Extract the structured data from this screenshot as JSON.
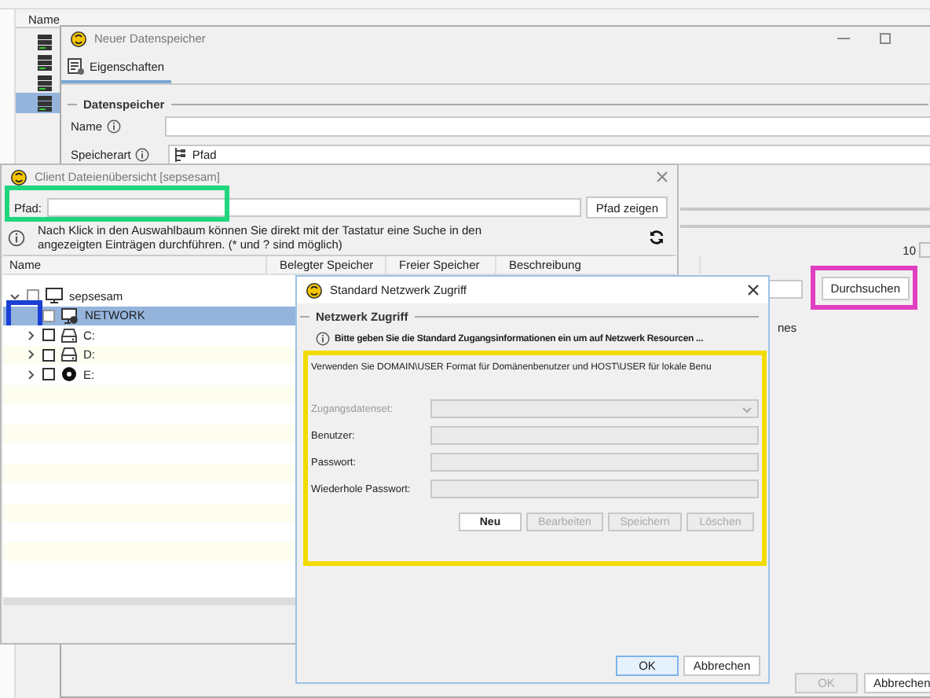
{
  "main": {
    "columns": [
      {
        "label": "Name"
      }
    ],
    "rows": [
      {
        "selected": false
      },
      {
        "selected": false
      },
      {
        "selected": false
      },
      {
        "selected": true
      }
    ]
  },
  "datastore_window": {
    "title": "Neuer Datenspeicher",
    "tabs": [
      {
        "label": "Eigenschaften",
        "selected": true
      }
    ],
    "group": "Datenspeicher",
    "fields": [
      {
        "label": "Name",
        "kind": "text"
      },
      {
        "label": "Speicherart",
        "kind": "select",
        "value": "Pfad"
      }
    ],
    "spinner_value": "10",
    "browse_button": "Durchsuchen",
    "partial_label": "nes",
    "buttons": [
      {
        "label": "OK",
        "disabled": true
      },
      {
        "label": "Abbrechen",
        "disabled": false
      }
    ]
  },
  "client_window": {
    "title": "Client Dateienübersicht [sepsesam]",
    "path_label": "Pfad:",
    "show_path_button": "Pfad zeigen",
    "info": "Nach Klick in den Auswahlbaum können Sie direkt mit der Tastatur eine Suche in den angezeigten Einträgen durchführen. (* und ? sind möglich)",
    "columns": [
      "Name",
      "Belegter Speicher",
      "Freier Speicher",
      "Beschreibung"
    ],
    "tree": [
      {
        "label": "sepsesam",
        "kind": "computer",
        "expanded": true,
        "checked": false,
        "selected": false,
        "children": [
          {
            "label": "NETWORK",
            "kind": "network",
            "checked": false,
            "selected": true
          },
          {
            "label": "C:",
            "kind": "drive",
            "expanded": false,
            "checked": false,
            "selected": false
          },
          {
            "label": "D:",
            "kind": "drive",
            "expanded": false,
            "checked": false,
            "selected": false
          },
          {
            "label": "E:",
            "kind": "disc",
            "expanded": false,
            "checked": false,
            "selected": false
          }
        ]
      }
    ]
  },
  "network_dialog": {
    "title": "Standard Netzwerk Zugriff",
    "group": "Netzwerk Zugriff",
    "notice": "Bitte geben Sie die Standard Zugangsinformationen ein um auf Netzwerk Resourcen ...",
    "hint": "Verwenden Sie DOMAIN\\USER Format für Domänenbenutzer und HOST\\USER für lokale Benu",
    "fields": [
      {
        "label": "Zugangsdatenset:",
        "kind": "select",
        "disabled": true
      },
      {
        "label": "Benutzer:",
        "kind": "text",
        "disabled": false
      },
      {
        "label": "Passwort:",
        "kind": "text",
        "disabled": false
      },
      {
        "label": "Wiederhole Passwort:",
        "kind": "text",
        "disabled": false
      }
    ],
    "actions": [
      {
        "label": "Neu",
        "disabled": false
      },
      {
        "label": "Bearbeiten",
        "disabled": true
      },
      {
        "label": "Speichern",
        "disabled": true
      },
      {
        "label": "Löschen",
        "disabled": true
      }
    ],
    "buttons": [
      {
        "label": "OK",
        "selected": true
      },
      {
        "label": "Abbrechen",
        "selected": false
      }
    ]
  },
  "annotations": [
    {
      "color": "#1fd67d"
    },
    {
      "color": "#1a3fd6"
    },
    {
      "color": "#e040c0"
    },
    {
      "color": "#f2dc00"
    }
  ]
}
